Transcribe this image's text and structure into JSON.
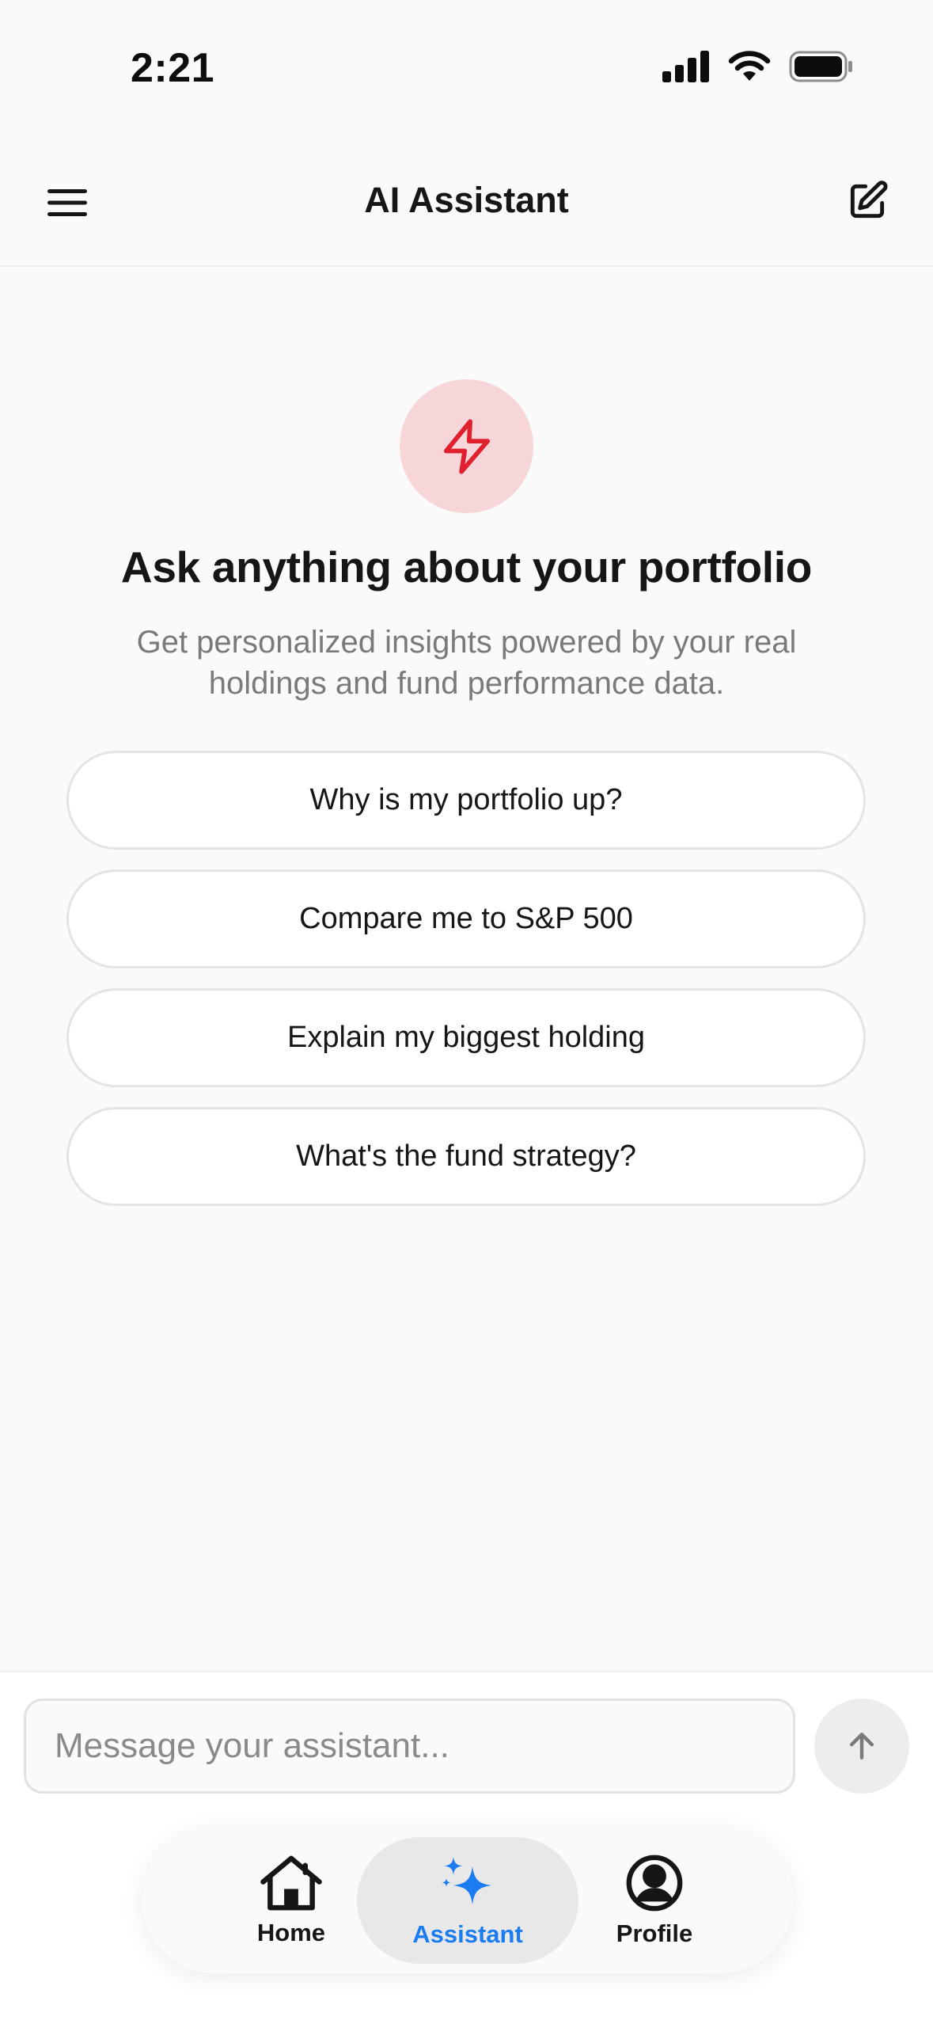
{
  "status_bar": {
    "time": "2:21"
  },
  "header": {
    "title": "AI Assistant"
  },
  "hero": {
    "icon": "lightning-bolt-icon",
    "title": "Ask anything about your portfolio",
    "subtitle": "Get personalized insights powered by your real holdings and fund performance data."
  },
  "suggestions": [
    {
      "label": "Why is my portfolio up?"
    },
    {
      "label": "Compare me to S&P 500"
    },
    {
      "label": "Explain my biggest holding"
    },
    {
      "label": "What's the fund strategy?"
    }
  ],
  "composer": {
    "placeholder": "Message your assistant...",
    "value": ""
  },
  "tabs": [
    {
      "label": "Home",
      "icon": "house-icon",
      "active": false
    },
    {
      "label": "Assistant",
      "icon": "sparkles-icon",
      "active": true
    },
    {
      "label": "Profile",
      "icon": "person-circle-icon",
      "active": false
    }
  ],
  "colors": {
    "accent_red": "#e0202f",
    "badge_bg": "#f7d6da",
    "active_tab": "#1a7cf0",
    "background": "#fafafa"
  }
}
